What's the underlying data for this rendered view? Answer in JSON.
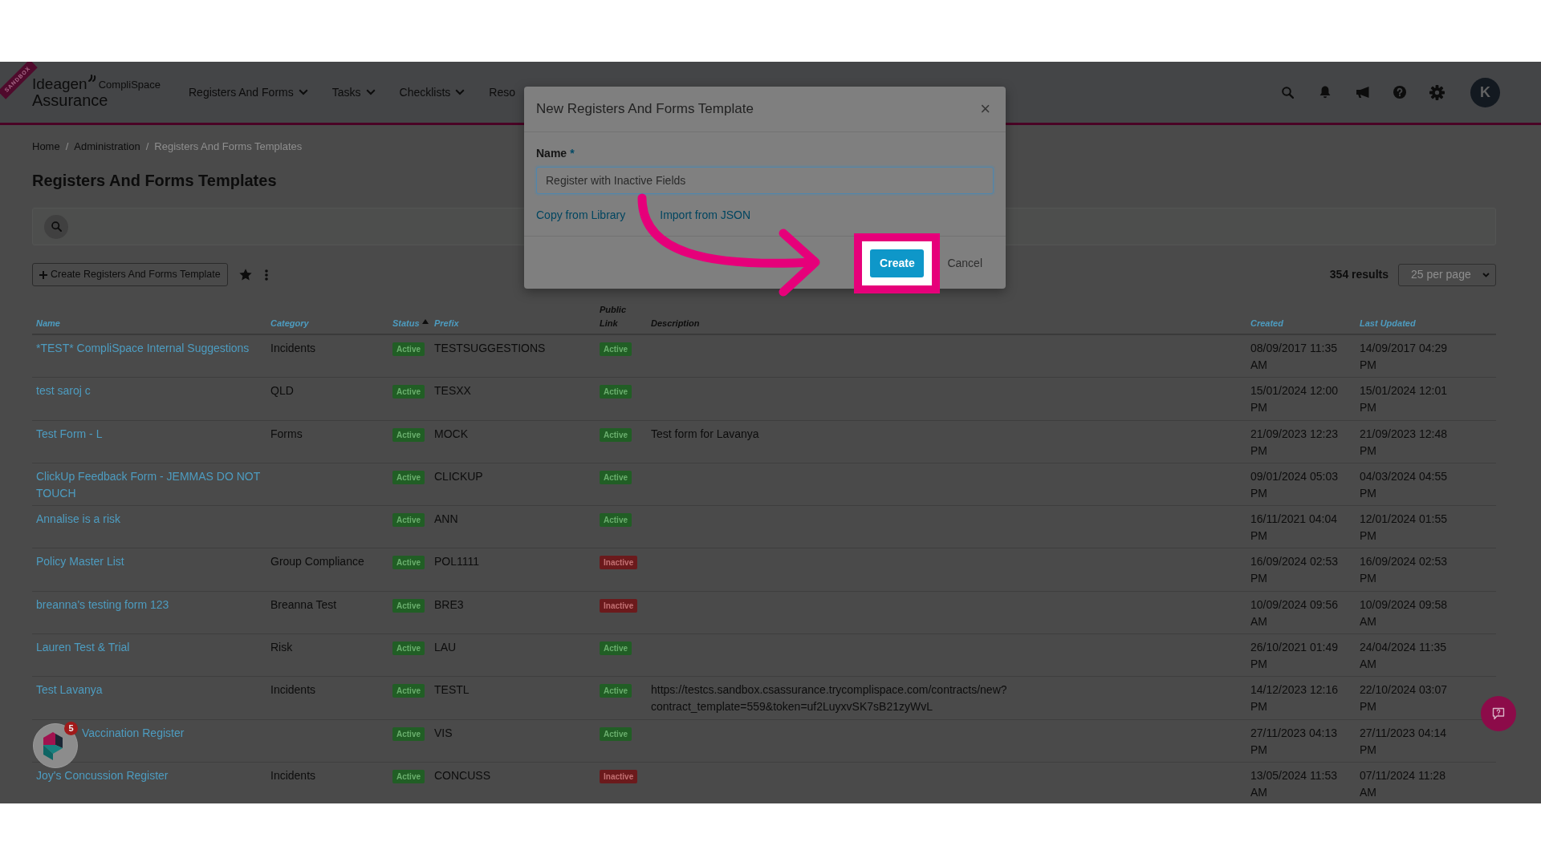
{
  "navbar": {
    "environment_badge": "SANDBOX",
    "logo": {
      "brand": "Ideagen",
      "product": "CompliSpace",
      "edition": "Assurance"
    },
    "menu": [
      {
        "label": "Registers And Forms",
        "has_dropdown": true
      },
      {
        "label": "Tasks",
        "has_dropdown": true
      },
      {
        "label": "Checklists",
        "has_dropdown": true
      },
      {
        "label": "Reso",
        "has_dropdown": false
      }
    ],
    "user_initial": "K"
  },
  "breadcrumbs": {
    "separator": "/",
    "items": [
      {
        "label": "Home",
        "current": false
      },
      {
        "label": "Administration",
        "current": false
      },
      {
        "label": "Registers And Forms Templates",
        "current": true
      }
    ]
  },
  "page_title": "Registers And Forms Templates",
  "toolbar": {
    "create_button": "Create Registers And Forms Template",
    "results": "354 results",
    "per_page": "25 per page"
  },
  "table": {
    "columns": [
      {
        "label": "Name",
        "sortable": true,
        "sorted": false
      },
      {
        "label": "Category",
        "sortable": true,
        "sorted": false
      },
      {
        "label": "Status",
        "sortable": true,
        "sorted": true
      },
      {
        "label": "Prefix",
        "sortable": true,
        "sorted": false
      },
      {
        "label": "Public Link",
        "sortable": false,
        "sorted": false
      },
      {
        "label": "Description",
        "sortable": false,
        "sorted": false
      },
      {
        "label": "Created",
        "sortable": true,
        "sorted": false
      },
      {
        "label": "Last Updated",
        "sortable": true,
        "sorted": false
      }
    ],
    "rows": [
      {
        "name": "*TEST* CompliSpace Internal Suggestions",
        "category": "Incidents",
        "status": {
          "label": "Active",
          "active": true
        },
        "prefix": "TESTSUGGESTIONS",
        "public_link": {
          "label": "Active",
          "active": true
        },
        "created": "08/09/2017 11:35 AM",
        "last_updated": "14/09/2017 04:29 PM"
      },
      {
        "name": "test saroj c",
        "category": "QLD",
        "status": {
          "label": "Active",
          "active": true
        },
        "prefix": "TESXX",
        "public_link": {
          "label": "Active",
          "active": true
        },
        "created": "15/01/2024 12:00 PM",
        "last_updated": "15/01/2024 12:01 PM"
      },
      {
        "name": "Test Form - L",
        "category": "Forms",
        "status": {
          "label": "Active",
          "active": true
        },
        "prefix": "MOCK",
        "public_link": {
          "label": "Active",
          "active": true
        },
        "description": "Test form for Lavanya",
        "created": "21/09/2023 12:23 PM",
        "last_updated": "21/09/2023 12:48 PM"
      },
      {
        "name": "ClickUp Feedback Form - JEMMAS DO NOT TOUCH",
        "status": {
          "label": "Active",
          "active": true
        },
        "prefix": "CLICKUP",
        "public_link": {
          "label": "Active",
          "active": true
        },
        "created": "09/01/2024 05:03 PM",
        "last_updated": "04/03/2024 04:55 PM"
      },
      {
        "name": "Annalise is a risk",
        "status": {
          "label": "Active",
          "active": true
        },
        "prefix": "ANN",
        "public_link": {
          "label": "Active",
          "active": true
        },
        "created": "16/11/2021 04:04 PM",
        "last_updated": "12/01/2024 01:55 PM"
      },
      {
        "name": "Policy Master List",
        "category": "Group Compliance",
        "status": {
          "label": "Active",
          "active": true
        },
        "prefix": "POL1111",
        "public_link": {
          "label": "Inactive",
          "active": false
        },
        "created": "16/09/2024 02:53 PM",
        "last_updated": "16/09/2024 02:53 PM"
      },
      {
        "name": "breanna's testing form 123",
        "category": "Breanna Test",
        "status": {
          "label": "Active",
          "active": true
        },
        "prefix": "BRE3",
        "public_link": {
          "label": "Inactive",
          "active": false
        },
        "created": "10/09/2024 09:56 AM",
        "last_updated": "10/09/2024 09:58 AM"
      },
      {
        "name": "Lauren Test & Trial",
        "category": "Risk",
        "status": {
          "label": "Active",
          "active": true
        },
        "prefix": "LAU",
        "public_link": {
          "label": "Active",
          "active": true
        },
        "created": "26/10/2021 01:49 PM",
        "last_updated": "24/04/2024 11:35 AM"
      },
      {
        "name": "Test Lavanya",
        "category": "Incidents",
        "status": {
          "label": "Active",
          "active": true
        },
        "prefix": "TESTL",
        "public_link": {
          "label": "Active",
          "active": true
        },
        "description": "https://testcs.sandbox.csassurance.trycomplispace.com/contracts/new?contract_template=559&token=uf2LuyxvSK7sB21zyWvL",
        "created": "14/12/2023 12:16 PM",
        "last_updated": "22/10/2024 03:07 PM"
      },
      {
        "name": "Vaccination Register",
        "name_partly_hidden": true,
        "status": {
          "label": "Active",
          "active": true
        },
        "prefix": "VIS",
        "public_link": {
          "label": "Active",
          "active": true
        },
        "created": "27/11/2023 04:13 PM",
        "last_updated": "27/11/2023 04:14 PM"
      },
      {
        "name": "Joy's Concussion Register",
        "category": "Incidents",
        "status": {
          "label": "Active",
          "active": true
        },
        "prefix": "CONCUSS",
        "public_link": {
          "label": "Inactive",
          "active": false
        },
        "created": "13/05/2024 11:53 AM",
        "last_updated": "07/11/2024 11:28 AM"
      }
    ]
  },
  "help_widget": {
    "badge": "5"
  },
  "modal": {
    "title": "New Registers And Forms Template",
    "close": "×",
    "field_label": "Name",
    "required_mark": "*",
    "field_value": "Register with Inactive Fields",
    "links": [
      "Copy from Library",
      "Import from JSON"
    ],
    "create_button": "Create",
    "create_highlighted": true,
    "cancel_button": "Cancel"
  }
}
